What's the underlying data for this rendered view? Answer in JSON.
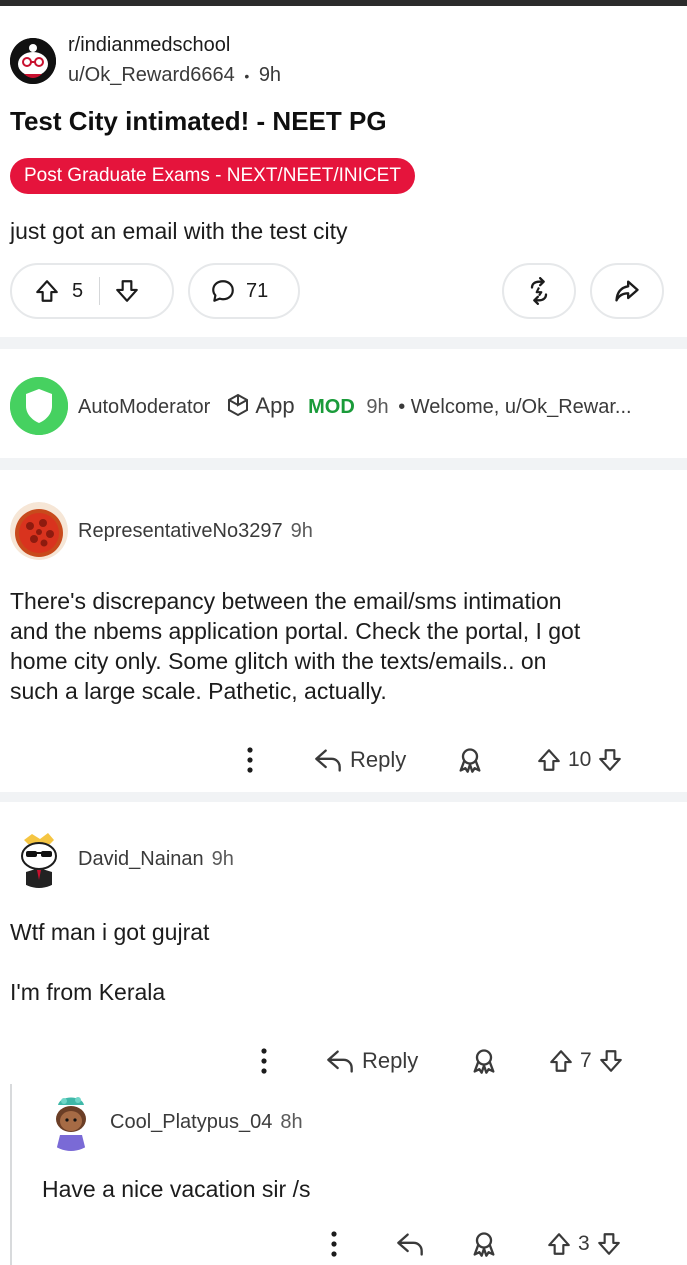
{
  "post": {
    "subreddit": "r/indianmedschool",
    "author": "u/Ok_Reward6664",
    "separator": "•",
    "time": "9h",
    "title": "Test City intimated! - NEET PG",
    "flair": "Post Graduate Exams - NEXT/NEET/INICET",
    "body": "just got an email with the test city",
    "score": "5",
    "comments": "71"
  },
  "automod": {
    "name": "AutoModerator",
    "app_label": "App",
    "mod_label": "MOD",
    "time": "9h",
    "preview": "• Welcome, u/Ok_Rewar..."
  },
  "comments": [
    {
      "user": "RepresentativeNo3297",
      "time": "9h",
      "lines": [
        "There's discrepancy between the email/sms intimation",
        "and the nbems application portal. Check the portal, I got",
        "home city only. Some glitch with the texts/emails.. on",
        "such a large scale. Pathetic, actually."
      ],
      "reply_label": "Reply",
      "score": "10"
    },
    {
      "user": "David_Nainan",
      "time": "9h",
      "line1": "Wtf man i got gujrat",
      "line2": "I'm from Kerala",
      "reply_label": "Reply",
      "score": "7"
    },
    {
      "user": "Cool_Platypus_04",
      "time": "8h",
      "body": "Have a nice vacation sir /s",
      "score": "3"
    }
  ],
  "colors": {
    "flair_bg": "#e5143c",
    "mod_green": "#1a9b3a",
    "automod_avatar": "#46d160",
    "separator_bg": "#f1f3f5"
  }
}
